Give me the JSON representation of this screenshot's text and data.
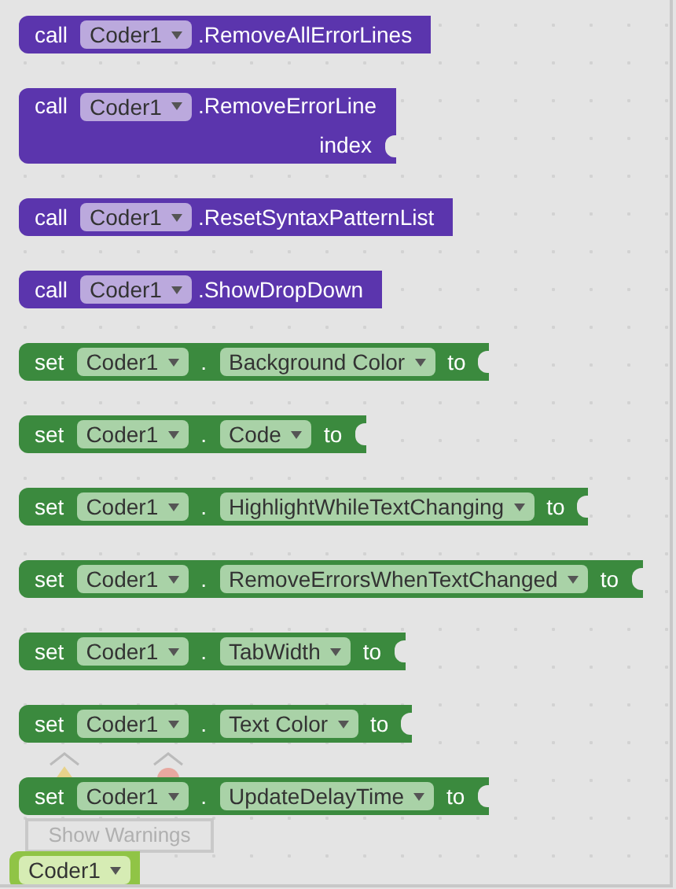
{
  "blocks": [
    {
      "kind": "call",
      "keyword": "call",
      "component": "Coder1",
      "method": ".RemoveAllErrorLines"
    },
    {
      "kind": "call",
      "keyword": "call",
      "component": "Coder1",
      "method": ".RemoveErrorLine",
      "params": [
        "index"
      ]
    },
    {
      "kind": "call",
      "keyword": "call",
      "component": "Coder1",
      "method": ".ResetSyntaxPatternList"
    },
    {
      "kind": "call",
      "keyword": "call",
      "component": "Coder1",
      "method": ".ShowDropDown"
    },
    {
      "kind": "set",
      "keyword": "set",
      "component": "Coder1",
      "dot": ".",
      "property": "Background Color",
      "to": "to"
    },
    {
      "kind": "set",
      "keyword": "set",
      "component": "Coder1",
      "dot": ".",
      "property": "Code",
      "to": "to"
    },
    {
      "kind": "set",
      "keyword": "set",
      "component": "Coder1",
      "dot": ".",
      "property": "HighlightWhileTextChanging",
      "to": "to"
    },
    {
      "kind": "set",
      "keyword": "set",
      "component": "Coder1",
      "dot": ".",
      "property": "RemoveErrorsWhenTextChanged",
      "to": "to"
    },
    {
      "kind": "set",
      "keyword": "set",
      "component": "Coder1",
      "dot": ".",
      "property": "TabWidth",
      "to": "to"
    },
    {
      "kind": "set",
      "keyword": "set",
      "component": "Coder1",
      "dot": ".",
      "property": "Text Color",
      "to": "to"
    },
    {
      "kind": "set",
      "keyword": "set",
      "component": "Coder1",
      "dot": ".",
      "property": "UpdateDelayTime",
      "to": "to"
    }
  ],
  "warnings": {
    "button": "Show Warnings"
  },
  "getter": {
    "kind": "component",
    "component": "Coder1"
  }
}
